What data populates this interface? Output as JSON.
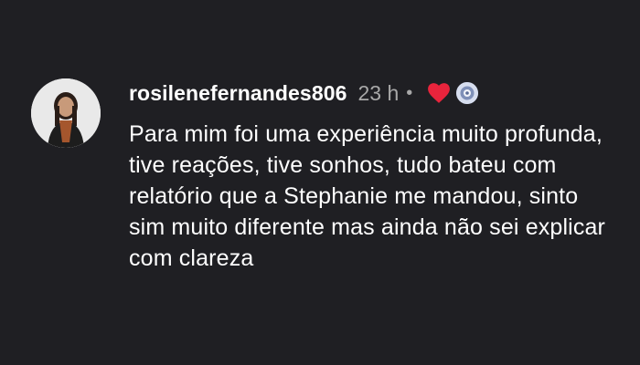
{
  "comment": {
    "username": "rosilenefernandes806",
    "timestamp": "23 h",
    "separator": "•",
    "liked_by_creator_icon": "heart-icon",
    "creator_avatar_icon": "creator-avatar-icon",
    "text": "Para mim foi uma experiência muito profunda, tive reações, tive sonhos, tudo bateu com relatório que a Stephanie me mandou, sinto sim muito diferente mas ainda não sei explicar com clareza"
  },
  "colors": {
    "background": "#1f1f23",
    "text": "#ffffff",
    "muted": "#a8a8a8",
    "heart": "#e8243c"
  }
}
